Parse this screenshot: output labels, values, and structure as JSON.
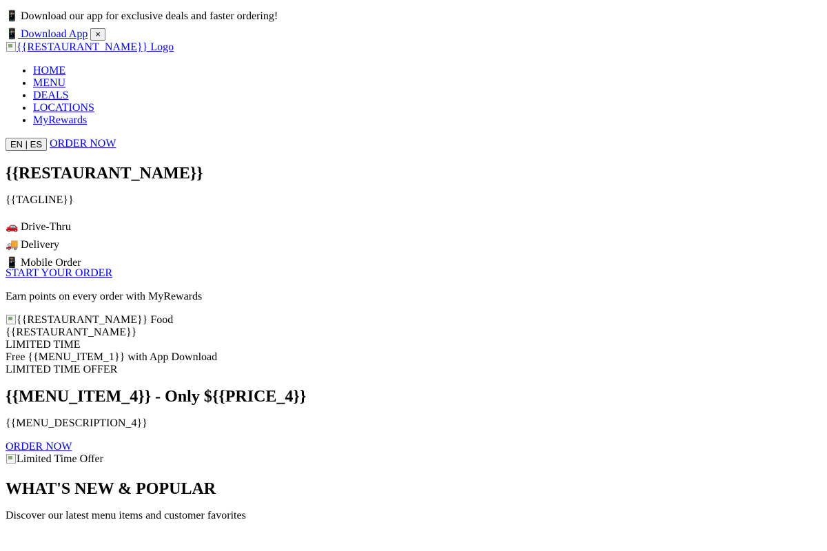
{
  "app_banner": {
    "icon": "mobile-phone-icon",
    "text": "Download our app for exclusive deals and faster ordering!",
    "download_label": "Download App",
    "close_label": "×"
  },
  "header": {
    "logo_alt": "{{RESTAURANT_NAME}} Logo",
    "nav": [
      {
        "label": "HOME"
      },
      {
        "label": "MENU"
      },
      {
        "label": "DEALS"
      },
      {
        "label": "LOCATIONS"
      },
      {
        "label": "MyRewards"
      }
    ],
    "lang_label": "EN | ES",
    "order_now_label": "ORDER NOW"
  },
  "hero": {
    "title": "{{RESTAURANT_NAME}}",
    "tagline": "{{TAGLINE}}",
    "features": [
      {
        "icon": "car-icon",
        "label": "Drive-Thru"
      },
      {
        "icon": "delivery-truck-icon",
        "label": "Delivery"
      },
      {
        "icon": "mobile-phone-icon",
        "label": "Mobile Order"
      }
    ],
    "cta_label": "START YOUR ORDER",
    "rewards_text": "Earn points on every order with MyRewards",
    "image_alt": "{{RESTAURANT_NAME}} Food",
    "image_caption": "{{RESTAURANT_NAME}}",
    "badge": "LIMITED TIME",
    "promo_text": "Free {{MENU_ITEM_1}} with App Download"
  },
  "offer": {
    "label": "LIMITED TIME OFFER",
    "title": "{{MENU_ITEM_4}} - Only ${{PRICE_4}}",
    "description": "{{MENU_DESCRIPTION_4}}",
    "cta_label": "ORDER NOW",
    "image_alt": "Limited Time Offer"
  },
  "popular": {
    "title": "WHAT'S NEW & POPULAR",
    "subtitle": "Discover our latest menu items and customer favorites"
  }
}
